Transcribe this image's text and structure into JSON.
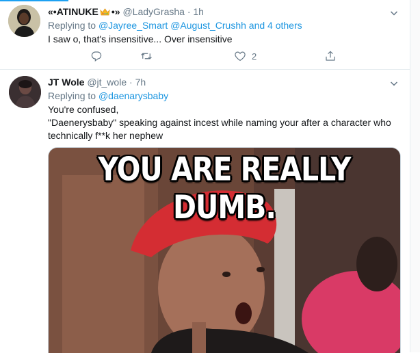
{
  "tweets": [
    {
      "name_prefix": "«•ATINUKE",
      "name_suffix": "•»",
      "handle": "@LadyGrasha",
      "dot": "·",
      "time": "1h",
      "replying_label": "Replying to",
      "mentions": [
        "@Jayree_Smart",
        "@August_Crushh"
      ],
      "others": "and 4 others",
      "text": "I saw o, that's insensitive... Over insensitive",
      "actions": {
        "likes": "2"
      }
    },
    {
      "name": "JT Wole",
      "handle": "@jt_wole",
      "dot": "·",
      "time": "7h",
      "replying_label": "Replying to",
      "mentions": [
        "@daenarysbaby"
      ],
      "text_line1": "You're confused,",
      "text_line2": "\"Daenerysbaby\" speaking against incest while naming your after a character who technically f**k her nephew",
      "media_caption": "YOU ARE REALLY DUMB."
    }
  ],
  "colors": {
    "accent": "#1da1f2",
    "link": "#1b95e0",
    "muted": "#657786",
    "border": "#e6ecf0"
  },
  "icons": [
    "chevron-down-icon",
    "reply-icon",
    "retweet-icon",
    "heart-icon",
    "share-icon",
    "crown-emoji-icon"
  ]
}
